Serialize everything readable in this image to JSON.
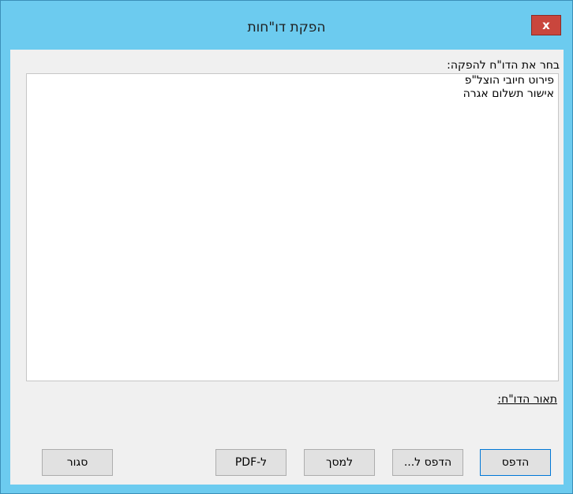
{
  "window": {
    "title": "הפקת דו\"חות",
    "close_label": "x"
  },
  "report_select": {
    "label": "בחר את הדו\"ח להפקה:",
    "items": [
      "פירוט חיובי הוצל\"פ",
      "אישור תשלום אגרה"
    ]
  },
  "description": {
    "label": "תאור הדו\"ח:"
  },
  "buttons": {
    "print": "הדפס",
    "print_to": "הדפס ל...",
    "to_screen": "למסך",
    "to_pdf": "ל-PDF",
    "close": "סגור"
  },
  "colors": {
    "title_bar": "#6ccbef",
    "close_button": "#c9463d",
    "client_area": "#f0f0f0",
    "default_button_border": "#0078d7"
  }
}
